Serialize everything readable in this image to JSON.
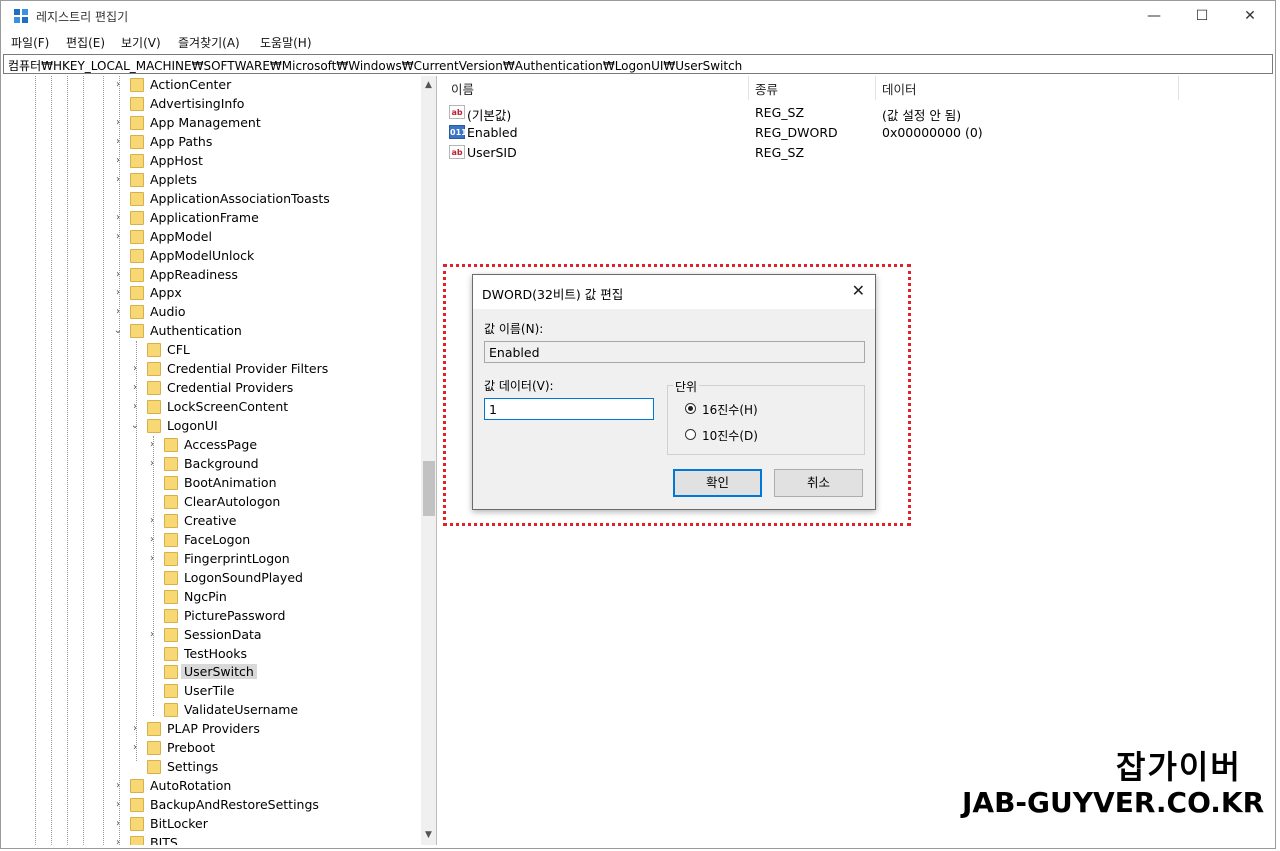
{
  "window": {
    "title": "레지스트리 편집기",
    "minimize_glyph": "—",
    "maximize_glyph": "☐",
    "close_glyph": "✕"
  },
  "menu": [
    "파일(F)",
    "편집(E)",
    "보기(V)",
    "즐겨찾기(A)",
    "도움말(H)"
  ],
  "address": "컴퓨터₩HKEY_LOCAL_MACHINE₩SOFTWARE₩Microsoft₩Windows₩CurrentVersion₩Authentication₩LogonUI₩UserSwitch",
  "tree": [
    {
      "label": "ActionCenter",
      "depth": 0,
      "expander": "collapsed"
    },
    {
      "label": "AdvertisingInfo",
      "depth": 0,
      "expander": "none"
    },
    {
      "label": "App Management",
      "depth": 0,
      "expander": "collapsed"
    },
    {
      "label": "App Paths",
      "depth": 0,
      "expander": "collapsed"
    },
    {
      "label": "AppHost",
      "depth": 0,
      "expander": "collapsed"
    },
    {
      "label": "Applets",
      "depth": 0,
      "expander": "collapsed"
    },
    {
      "label": "ApplicationAssociationToasts",
      "depth": 0,
      "expander": "none"
    },
    {
      "label": "ApplicationFrame",
      "depth": 0,
      "expander": "collapsed"
    },
    {
      "label": "AppModel",
      "depth": 0,
      "expander": "collapsed"
    },
    {
      "label": "AppModelUnlock",
      "depth": 0,
      "expander": "none"
    },
    {
      "label": "AppReadiness",
      "depth": 0,
      "expander": "collapsed"
    },
    {
      "label": "Appx",
      "depth": 0,
      "expander": "collapsed"
    },
    {
      "label": "Audio",
      "depth": 0,
      "expander": "collapsed"
    },
    {
      "label": "Authentication",
      "depth": 0,
      "expander": "expanded"
    },
    {
      "label": "CFL",
      "depth": 1,
      "expander": "none"
    },
    {
      "label": "Credential Provider Filters",
      "depth": 1,
      "expander": "collapsed"
    },
    {
      "label": "Credential Providers",
      "depth": 1,
      "expander": "collapsed"
    },
    {
      "label": "LockScreenContent",
      "depth": 1,
      "expander": "collapsed"
    },
    {
      "label": "LogonUI",
      "depth": 1,
      "expander": "expanded"
    },
    {
      "label": "AccessPage",
      "depth": 2,
      "expander": "collapsed"
    },
    {
      "label": "Background",
      "depth": 2,
      "expander": "collapsed"
    },
    {
      "label": "BootAnimation",
      "depth": 2,
      "expander": "none"
    },
    {
      "label": "ClearAutologon",
      "depth": 2,
      "expander": "none"
    },
    {
      "label": "Creative",
      "depth": 2,
      "expander": "collapsed"
    },
    {
      "label": "FaceLogon",
      "depth": 2,
      "expander": "collapsed"
    },
    {
      "label": "FingerprintLogon",
      "depth": 2,
      "expander": "collapsed"
    },
    {
      "label": "LogonSoundPlayed",
      "depth": 2,
      "expander": "none"
    },
    {
      "label": "NgcPin",
      "depth": 2,
      "expander": "none"
    },
    {
      "label": "PicturePassword",
      "depth": 2,
      "expander": "none"
    },
    {
      "label": "SessionData",
      "depth": 2,
      "expander": "collapsed"
    },
    {
      "label": "TestHooks",
      "depth": 2,
      "expander": "none"
    },
    {
      "label": "UserSwitch",
      "depth": 2,
      "expander": "none",
      "selected": true
    },
    {
      "label": "UserTile",
      "depth": 2,
      "expander": "none"
    },
    {
      "label": "ValidateUsername",
      "depth": 2,
      "expander": "none"
    },
    {
      "label": "PLAP Providers",
      "depth": 1,
      "expander": "collapsed"
    },
    {
      "label": "Preboot",
      "depth": 1,
      "expander": "collapsed"
    },
    {
      "label": "Settings",
      "depth": 1,
      "expander": "none"
    },
    {
      "label": "AutoRotation",
      "depth": 0,
      "expander": "collapsed"
    },
    {
      "label": "BackupAndRestoreSettings",
      "depth": 0,
      "expander": "collapsed"
    },
    {
      "label": "BitLocker",
      "depth": 0,
      "expander": "collapsed"
    },
    {
      "label": "BITS",
      "depth": 0,
      "expander": "collapsed"
    }
  ],
  "columns": {
    "name": "이름",
    "type": "종류",
    "data": "데이터"
  },
  "values": [
    {
      "icon": "string-value-icon",
      "icon_text": "ab",
      "name": "(기본값)",
      "type": "REG_SZ",
      "data": "(값 설정 안 됨)"
    },
    {
      "icon": "binary-value-icon",
      "icon_text": "011",
      "name": "Enabled",
      "type": "REG_DWORD",
      "data": "0x00000000 (0)"
    },
    {
      "icon": "string-value-icon",
      "icon_text": "ab",
      "name": "UserSID",
      "type": "REG_SZ",
      "data": ""
    }
  ],
  "dialog": {
    "title": "DWORD(32비트) 값 편집",
    "close_glyph": "✕",
    "value_name_label": "값 이름(N):",
    "value_name": "Enabled",
    "value_data_label": "값 데이터(V):",
    "value_data": "1",
    "base_label": "단위",
    "hex_label": "16진수(H)",
    "dec_label": "10진수(D)",
    "selected_base": "hex",
    "ok_label": "확인",
    "cancel_label": "취소"
  },
  "watermark": {
    "line1": "잡가이버",
    "line2": "JAB-GUYVER.CO.KR"
  },
  "colors": {
    "highlight": "#e0232b",
    "accent": "#0078d7",
    "folder": "#f8d775"
  }
}
